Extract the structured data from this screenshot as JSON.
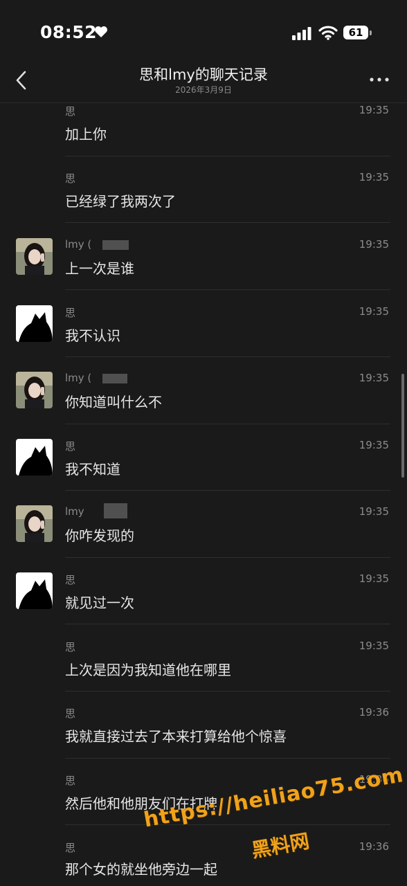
{
  "status_bar": {
    "time": "08:52",
    "battery": "61"
  },
  "nav": {
    "title": "思和lmy的聊天记录",
    "subtitle": "2026年3月9日"
  },
  "messages": [
    {
      "sender": "思",
      "time": "19:35",
      "text": "加上你",
      "avatar": "none"
    },
    {
      "sender": "思",
      "time": "19:35",
      "text": "已经绿了我两次了",
      "avatar": "none"
    },
    {
      "sender": "lmy (",
      "time": "19:35",
      "text": "上一次是谁",
      "avatar": "girl"
    },
    {
      "sender": "思",
      "time": "19:35",
      "text": "我不认识",
      "avatar": "cat"
    },
    {
      "sender": "lmy (",
      "time": "19:35",
      "text": "你知道叫什么不",
      "avatar": "girl"
    },
    {
      "sender": "思",
      "time": "19:35",
      "text": "我不知道",
      "avatar": "cat"
    },
    {
      "sender": "lmy",
      "time": "19:35",
      "text": "你咋发现的",
      "avatar": "girl"
    },
    {
      "sender": "思",
      "time": "19:35",
      "text": "就见过一次",
      "avatar": "cat"
    },
    {
      "sender": "思",
      "time": "19:35",
      "text": "上次是因为我知道他在哪里",
      "avatar": "none"
    },
    {
      "sender": "思",
      "time": "19:36",
      "text": "我就直接过去了本来打算给他个惊喜",
      "avatar": "none"
    },
    {
      "sender": "思",
      "time": "19:36",
      "text": "然后他和他朋友们在打牌",
      "avatar": "none"
    },
    {
      "sender": "思",
      "time": "19:36",
      "text": "那个女的就坐他旁边一起",
      "avatar": "none"
    }
  ],
  "watermark": {
    "url": "https://heiliao75.com",
    "name": "黑料网"
  },
  "icons": [
    "heart-icon",
    "signal-icon",
    "wifi-icon",
    "back-icon",
    "more-icon",
    "girl-avatar",
    "cat-avatar"
  ]
}
